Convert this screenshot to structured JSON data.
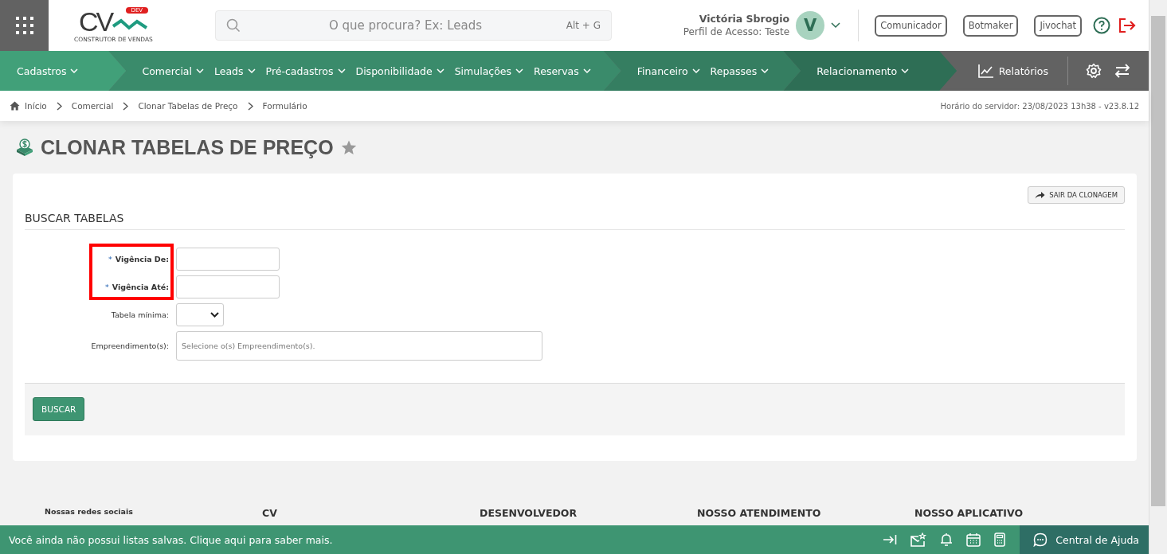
{
  "header": {
    "logo": {
      "letters": "CV",
      "badge": "DEV",
      "tagline": "CONSTRUTOR DE VENDAS"
    },
    "search": {
      "placeholder": "O que procura? Ex: Leads",
      "shortcut": "Alt + G"
    },
    "user": {
      "name": "Victória Sbrogio",
      "profile": "Perfil de Acesso: Teste",
      "initial": "V"
    },
    "buttons": [
      "Comunicador",
      "Botmaker",
      "Jivochat"
    ]
  },
  "nav": {
    "groups": [
      {
        "color": "#41a079",
        "items": [
          "Cadastros"
        ]
      },
      {
        "color": "#3a8b6b",
        "items": [
          "Comercial",
          "Leads",
          "Pré-cadastros",
          "Disponibilidade",
          "Simulações",
          "Reservas"
        ]
      },
      {
        "color": "#357e61",
        "items": [
          "Financeiro",
          "Repasses"
        ]
      },
      {
        "color": "#2e6e55",
        "items": [
          "Relacionamento"
        ]
      }
    ],
    "reports": "Relatórios"
  },
  "breadcrumb": [
    "Início",
    "Comercial",
    "Clonar Tabelas de Preço",
    "Formulário"
  ],
  "server_time": "Horário do servidor: 23/08/2023 13h38 - v23.8.12",
  "page_title": "CLONAR TABELAS DE PREÇO",
  "card": {
    "exit_button": "SAIR DA CLONAGEM",
    "section_title": "BUSCAR TABELAS",
    "groups": [
      {
        "highlighted": true,
        "fields": [
          {
            "kind": "text",
            "label": "Vigência De:",
            "required_mark": "*"
          },
          {
            "kind": "text",
            "label": "Vigência Até:",
            "required_mark": "*"
          }
        ]
      },
      {
        "highlighted": false,
        "fields": [
          {
            "kind": "select",
            "label": "Tabela mínima:"
          },
          {
            "kind": "multiselect",
            "label": "Empreendimento(s):",
            "placeholder": "Selecione o(s) Empreendimento(s)."
          }
        ]
      }
    ],
    "search_button": "BUSCAR"
  },
  "footer_headings": [
    "Nossas redes sociais",
    "CV",
    "DESENVOLVEDOR",
    "NOSSO ATENDIMENTO",
    "NOSSO APLICATIVO"
  ],
  "bottom_bar": {
    "message": "Você ainda não possui listas salvas. Clique aqui para saber mais.",
    "help": "Central de Ajuda"
  }
}
